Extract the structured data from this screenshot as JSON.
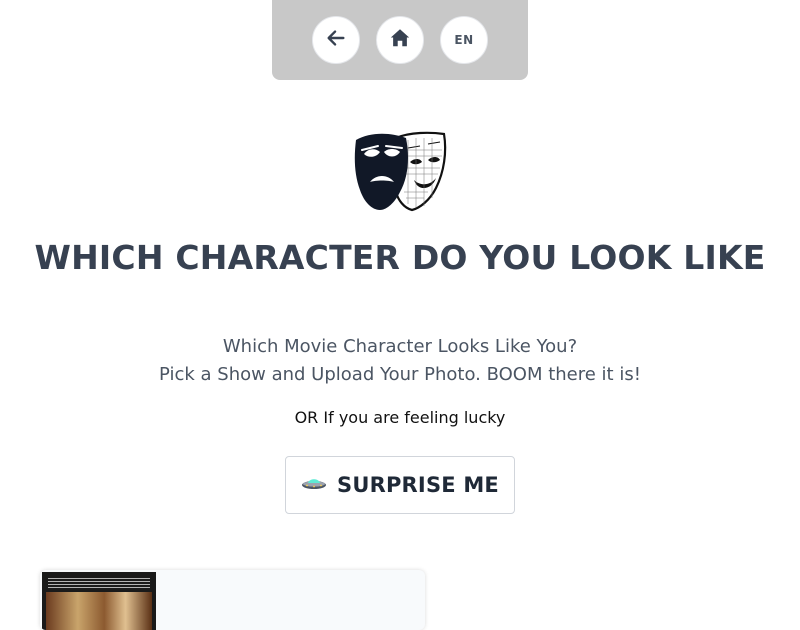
{
  "nav": {
    "back_icon": "arrow-left-icon",
    "home_icon": "home-icon",
    "language": "EN"
  },
  "logo": {
    "icon": "theater-masks-icon"
  },
  "hero": {
    "title": "WHICH CHARACTER DO YOU LOOK LIKE",
    "subtitle_line1": "Which Movie Character Looks Like You?",
    "subtitle_line2": "Pick a Show and Upload Your Photo. BOOM there it is!",
    "lucky_text": "OR If you are feeling lucky"
  },
  "surprise_button": {
    "icon": "ufo-icon",
    "label": "SURPRISE ME"
  },
  "colors": {
    "top_bar": "#c8c8c8",
    "title": "#374151",
    "subtitle": "#4b5563",
    "button_border": "#d1d5db"
  }
}
